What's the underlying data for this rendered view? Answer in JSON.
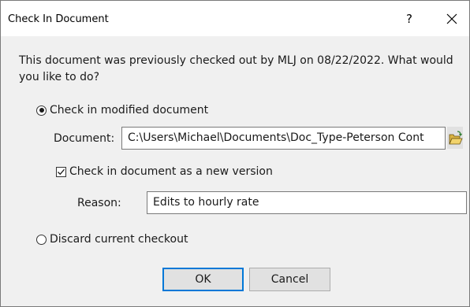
{
  "window": {
    "title": "Check In Document",
    "help_label": "?",
    "close_label": "✕"
  },
  "message": "This document was previously checked out by MLJ on 08/22/2022.  What would you like to do?",
  "options": {
    "check_in_label": "Check in modified document",
    "check_in_selected": true,
    "discard_label": "Discard current checkout",
    "discard_selected": false
  },
  "document": {
    "label": "Document:",
    "value": "C:\\Users\\Michael\\Documents\\Doc_Type-Peterson Cont",
    "browse_icon": "folder-open-icon"
  },
  "new_version": {
    "label": "Check in document as a new version",
    "checked": true
  },
  "reason": {
    "label": "Reason:",
    "value": "Edits to hourly rate"
  },
  "buttons": {
    "ok_label": "OK",
    "cancel_label": "Cancel"
  },
  "colors": {
    "accent": "#0078d7",
    "dialog_bg": "#f0f0f0"
  }
}
